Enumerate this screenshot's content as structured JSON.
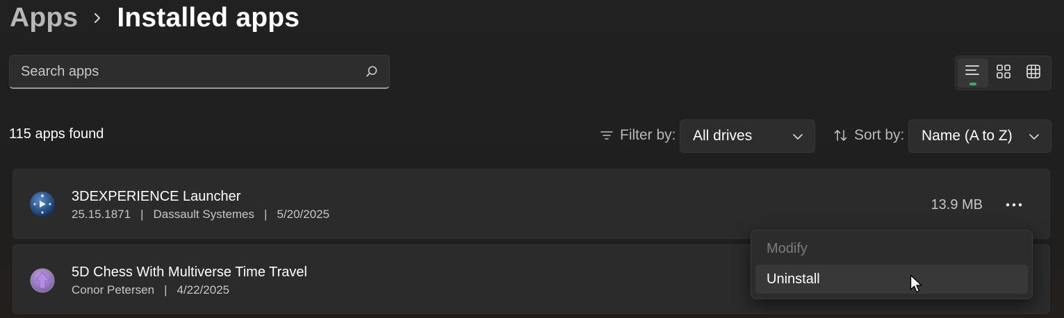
{
  "breadcrumb": {
    "parent": "Apps",
    "current": "Installed apps"
  },
  "search": {
    "placeholder": "Search apps",
    "value": ""
  },
  "views": [
    {
      "name": "list-view",
      "active": true
    },
    {
      "name": "grid-view",
      "active": false
    },
    {
      "name": "table-view",
      "active": false
    }
  ],
  "results": {
    "count_text": "115 apps found"
  },
  "filter": {
    "label": "Filter by:",
    "value": "All drives"
  },
  "sort": {
    "label": "Sort by:",
    "value": "Name (A to Z)"
  },
  "apps": [
    {
      "name": "3DEXPERIENCE Launcher",
      "version": "25.15.1871",
      "publisher": "Dassault Systemes",
      "date": "5/20/2025",
      "size": "13.9 MB"
    },
    {
      "name": "5D Chess With Multiverse Time Travel",
      "publisher": "Conor Petersen",
      "date": "4/22/2025"
    }
  ],
  "menu": {
    "items": [
      "Modify",
      "Uninstall"
    ]
  },
  "colors": {
    "accent": "#3fae5a",
    "background": "#202020",
    "card": "#2b2b2b"
  }
}
